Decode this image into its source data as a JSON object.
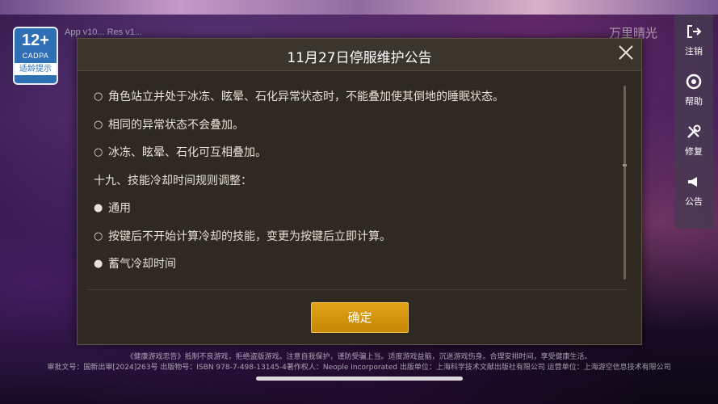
{
  "badge": {
    "age": "12+",
    "org": "CADPA",
    "tip": "适龄提示"
  },
  "version_text": "App v10...  Res v1...",
  "brand_text": "万里晴光",
  "side_menu": [
    {
      "label": "注销",
      "icon": "logout-icon"
    },
    {
      "label": "帮助",
      "icon": "help-icon"
    },
    {
      "label": "修复",
      "icon": "repair-icon"
    },
    {
      "label": "公告",
      "icon": "announcement-icon"
    }
  ],
  "dialog": {
    "title": "11月27日停服维护公告",
    "lines": [
      {
        "bullet": "○",
        "text": "角色站立并处于冰冻、眩晕、石化异常状态时，不能叠加使其倒地的睡眠状态。"
      },
      {
        "bullet": "○",
        "text": "相同的异常状态不会叠加。"
      },
      {
        "bullet": "○",
        "text": "冰冻、眩晕、石化可互相叠加。"
      },
      {
        "bullet": "",
        "text": "十九、技能冷却时间规则调整："
      },
      {
        "bullet": "●",
        "text": "通用"
      },
      {
        "bullet": "○",
        "text": "按键后不开始计算冷却的技能，变更为按键后立即计算。"
      },
      {
        "bullet": "●",
        "text": "蓄气冷却时间"
      }
    ],
    "confirm_label": "确定"
  },
  "footer": {
    "line1": "《健康游戏忠告》抵制不良游戏，拒绝盗版游戏。注意自我保护，谨防受骗上当。适度游戏益脑，沉迷游戏伤身。合理安排时间，享受健康生活。",
    "line2": "审批文号：国新出审[2024]263号  出版物号：ISBN 978-7-498-13145-4著作权人：Neople Incorporated 出版单位：上海科学技术文献出版社有限公司 运营单位：上海游空信息技术有限公司"
  },
  "colors": {
    "accent": "#e0a316",
    "dialog_bg": "#2e2a23",
    "badge_blue": "#2f6fb6"
  }
}
